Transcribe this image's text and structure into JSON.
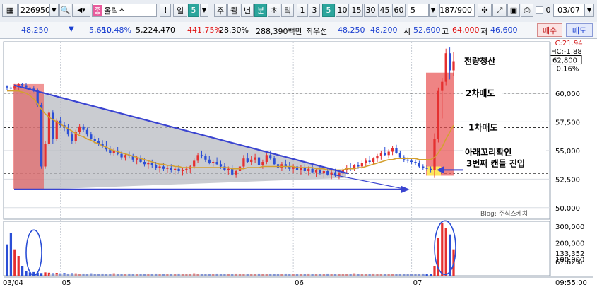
{
  "toolbar": {
    "stock_code": "226950",
    "stock_badge": "종",
    "stock_name": "올릭스",
    "period_label": "일",
    "period_value": "5",
    "periods": [
      "주",
      "월",
      "년",
      "분",
      "초",
      "틱"
    ],
    "minute_options": [
      "1",
      "3",
      "5",
      "10",
      "15",
      "30",
      "45",
      "60"
    ],
    "count_value": "5",
    "page_info": "187/900",
    "checkbox_value": "0",
    "date": "03/07"
  },
  "quote": {
    "price": "48,250",
    "change_arrow": "▼",
    "change": "5,650",
    "change_pct": "-10.48%",
    "volume": "5,224,470",
    "volume_ratio": "441.75%",
    "turnover": "28.30%",
    "amount": "288,390백만",
    "priority_label": "최우선",
    "ask": "48,250",
    "bid": "48,200",
    "open_label": "시",
    "open": "52,600",
    "high_label": "고",
    "high": "64,000",
    "low_label": "저",
    "low": "46,600",
    "buy_button": "매수",
    "sell_button": "매도"
  },
  "chart": {
    "right_top_lc": "LC:21.94",
    "right_top_hc": "HC:-1.88",
    "current_price_tag": "62,800",
    "current_pct_tag": "-0.16%",
    "price_ticks": [
      "60,000",
      "57,500",
      "55,000",
      "52,500",
      "50,000"
    ],
    "volume_ticks": [
      "300,000",
      "200,000",
      "100,000"
    ],
    "volume_tag": "133,352",
    "volume_pct_tag": "67.62%",
    "date_labels": [
      "03/04",
      "05",
      "06",
      "07"
    ],
    "time_label": "09:55:00",
    "annotations": {
      "all_sell": "전량청산",
      "second_sell": "2차매도",
      "first_sell": "1차매도",
      "confirm_line1": "아래꼬리확인",
      "confirm_line2": "3번째 캔들 진입",
      "blog": "Blog: 주식스케치"
    },
    "colors": {
      "up": "#e53030",
      "down": "#2b4fd6",
      "ma": "#d4a030",
      "triangle": "#3a44d0",
      "highlight": "#e85050"
    }
  },
  "chart_data": {
    "type": "candlestick",
    "y_axis_range": [
      49000,
      64500
    ],
    "reference_levels": [
      60000,
      57000,
      53000
    ],
    "candles": [
      [
        60600,
        60700,
        60300,
        60500
      ],
      [
        60500,
        60700,
        60300,
        60400
      ],
      [
        60400,
        60800,
        60200,
        60600
      ],
      [
        60600,
        60900,
        60300,
        60800
      ],
      [
        60800,
        60900,
        60500,
        60700
      ],
      [
        60700,
        60900,
        60400,
        60500
      ],
      [
        60500,
        60700,
        60300,
        60400
      ],
      [
        60400,
        60600,
        60100,
        60300
      ],
      [
        60300,
        60400,
        58800,
        59000
      ],
      [
        59000,
        59200,
        53400,
        53600
      ],
      [
        53600,
        55800,
        53400,
        55600
      ],
      [
        55600,
        58600,
        55400,
        58300
      ],
      [
        58300,
        58500,
        55600,
        56000
      ],
      [
        56000,
        57800,
        55800,
        57600
      ],
      [
        57600,
        57900,
        57000,
        57200
      ],
      [
        57200,
        57500,
        56700,
        57000
      ],
      [
        57000,
        57300,
        56200,
        56400
      ],
      [
        56400,
        56600,
        55600,
        55800
      ],
      [
        55800,
        56800,
        55600,
        56600
      ],
      [
        56600,
        57300,
        56400,
        57100
      ],
      [
        57100,
        57300,
        56600,
        56800
      ],
      [
        56800,
        57000,
        56200,
        56400
      ],
      [
        56400,
        56600,
        55800,
        56000
      ],
      [
        56000,
        56300,
        55600,
        55800
      ],
      [
        55800,
        56100,
        55400,
        55600
      ],
      [
        55600,
        55900,
        55200,
        55400
      ],
      [
        55400,
        55800,
        54900,
        55100
      ],
      [
        55100,
        55400,
        54600,
        54800
      ],
      [
        54800,
        55200,
        54500,
        55000
      ],
      [
        55000,
        55300,
        54600,
        54700
      ],
      [
        54700,
        54900,
        54200,
        54400
      ],
      [
        54400,
        54800,
        54100,
        54600
      ],
      [
        54600,
        54900,
        54300,
        54500
      ],
      [
        54500,
        54700,
        54000,
        54200
      ],
      [
        54200,
        54500,
        53800,
        54300
      ],
      [
        54300,
        54600,
        53900,
        54000
      ],
      [
        54000,
        54300,
        53600,
        53800
      ],
      [
        53800,
        54100,
        53400,
        53900
      ],
      [
        53900,
        54200,
        53500,
        53700
      ],
      [
        53700,
        54000,
        53300,
        53500
      ],
      [
        53500,
        53800,
        53100,
        53600
      ],
      [
        53600,
        53900,
        53200,
        53400
      ],
      [
        53400,
        53700,
        53000,
        53500
      ],
      [
        53500,
        53800,
        53100,
        53300
      ],
      [
        53300,
        53600,
        52900,
        53400
      ],
      [
        53400,
        53700,
        53000,
        53200
      ],
      [
        53200,
        53500,
        52800,
        53300
      ],
      [
        53300,
        53600,
        53000,
        53400
      ],
      [
        53400,
        53700,
        53000,
        53600
      ],
      [
        53600,
        54300,
        53400,
        54100
      ],
      [
        54100,
        54800,
        53900,
        54600
      ],
      [
        54600,
        55000,
        54300,
        54500
      ],
      [
        54500,
        54700,
        54000,
        54200
      ],
      [
        54200,
        54500,
        53800,
        53900
      ],
      [
        53900,
        54200,
        53600,
        54000
      ],
      [
        54000,
        54400,
        53700,
        53800
      ],
      [
        53800,
        54100,
        53400,
        53600
      ],
      [
        53600,
        53900,
        53200,
        53300
      ],
      [
        53300,
        53600,
        52900,
        53400
      ],
      [
        53400,
        53700,
        52800,
        52900
      ],
      [
        52900,
        53300,
        52600,
        53200
      ],
      [
        53200,
        53800,
        53000,
        53600
      ],
      [
        53600,
        54600,
        53400,
        54300
      ],
      [
        54300,
        54800,
        53900,
        54000
      ],
      [
        54000,
        54500,
        53700,
        54200
      ],
      [
        54200,
        54700,
        53900,
        54400
      ],
      [
        54400,
        54600,
        53600,
        53700
      ],
      [
        53700,
        54200,
        53400,
        54000
      ],
      [
        54000,
        54800,
        53800,
        54600
      ],
      [
        54600,
        55000,
        54200,
        54300
      ],
      [
        54300,
        54500,
        53700,
        53800
      ],
      [
        53800,
        54100,
        53300,
        53500
      ],
      [
        53500,
        54000,
        53200,
        53800
      ],
      [
        53800,
        54200,
        53400,
        53600
      ],
      [
        53600,
        54000,
        53200,
        53400
      ],
      [
        53400,
        53800,
        53000,
        53600
      ],
      [
        53600,
        53900,
        53200,
        53300
      ],
      [
        53300,
        53700,
        52900,
        53500
      ],
      [
        53500,
        53800,
        53000,
        53200
      ],
      [
        53200,
        53600,
        52800,
        53400
      ],
      [
        53400,
        53700,
        53000,
        53100
      ],
      [
        53100,
        53500,
        52700,
        53300
      ],
      [
        53300,
        53600,
        52900,
        53000
      ],
      [
        53000,
        53400,
        52600,
        53200
      ],
      [
        53200,
        53500,
        52800,
        52900
      ],
      [
        52900,
        53300,
        52500,
        53100
      ],
      [
        53100,
        53400,
        52700,
        52800
      ],
      [
        52800,
        53200,
        52500,
        53000
      ],
      [
        53000,
        53500,
        52800,
        53300
      ],
      [
        53300,
        53700,
        53000,
        53500
      ],
      [
        53500,
        53900,
        53200,
        53400
      ],
      [
        53400,
        53800,
        53200,
        53700
      ],
      [
        53700,
        54000,
        53400,
        53600
      ],
      [
        53600,
        54100,
        53400,
        53900
      ],
      [
        53900,
        54300,
        53600,
        54100
      ],
      [
        54100,
        54500,
        53800,
        54000
      ],
      [
        54000,
        54400,
        53700,
        54300
      ],
      [
        54300,
        54700,
        54000,
        54500
      ],
      [
        54500,
        55000,
        54200,
        54800
      ],
      [
        54800,
        55300,
        54500,
        54600
      ],
      [
        54600,
        55100,
        54300,
        54900
      ],
      [
        54900,
        55400,
        54600,
        55200
      ],
      [
        55200,
        55500,
        54700,
        54800
      ],
      [
        54800,
        55000,
        54300,
        54400
      ],
      [
        54400,
        54600,
        54000,
        54200
      ],
      [
        54200,
        54400,
        53900,
        54100
      ],
      [
        54100,
        54300,
        53800,
        54000
      ],
      [
        54000,
        54200,
        53700,
        53900
      ],
      [
        53900,
        54100,
        53500,
        53600
      ],
      [
        53600,
        53800,
        53300,
        53500
      ],
      [
        53500,
        53700,
        53200,
        53400
      ],
      [
        53400,
        53600,
        53100,
        53300
      ],
      [
        53300,
        56500,
        52600,
        56000
      ],
      [
        56000,
        60500,
        55700,
        60200
      ],
      [
        60200,
        61300,
        57800,
        61000
      ],
      [
        61000,
        63900,
        60700,
        63500
      ],
      [
        63500,
        64000,
        61200,
        62000
      ],
      [
        62000,
        63600,
        61500,
        62800
      ]
    ],
    "ma_series": [
      60200,
      60200,
      60200,
      60200,
      60100,
      60000,
      59800,
      59500,
      59100,
      58600,
      58200,
      57900,
      57700,
      57500,
      57300,
      57100,
      56900,
      56700,
      56500,
      56300,
      56200,
      56000,
      55900,
      55700,
      55600,
      55400,
      55300,
      55100,
      55000,
      54900,
      54800,
      54700,
      54600,
      54500,
      54400,
      54300,
      54200,
      54100,
      54000,
      53900,
      53800,
      53800,
      53700,
      53700,
      53600,
      53600,
      53500,
      53500,
      53500,
      53500,
      53500,
      53500,
      53500,
      53500,
      53500,
      53500,
      53500,
      53500,
      53500,
      53400,
      53400,
      53400,
      53400,
      53500,
      53500,
      53500,
      53500,
      53600,
      53600,
      53600,
      53600,
      53600,
      53600,
      53600,
      53600,
      53600,
      53500,
      53500,
      53500,
      53500,
      53500,
      53400,
      53400,
      53400,
      53300,
      53300,
      53300,
      53300,
      53300,
      53400,
      53400,
      53400,
      53500,
      53500,
      53600,
      53700,
      53800,
      53900,
      54000,
      54100,
      54200,
      54200,
      54300,
      54300,
      54300,
      54300,
      54300,
      54300,
      54200,
      54200,
      54200,
      54200,
      54400,
      54800,
      55300,
      56000,
      56600,
      57200
    ],
    "volume": [
      190000,
      260000,
      160000,
      120000,
      60000,
      30000,
      20000,
      22000,
      18000,
      16000,
      20000,
      18000,
      15000,
      17000,
      14000,
      16000,
      13000,
      15000,
      14000,
      12000,
      13000,
      12000,
      14000,
      11000,
      12000,
      13000,
      11000,
      12000,
      14000,
      10000,
      12000,
      11000,
      13000,
      10000,
      12000,
      11000,
      10000,
      12000,
      11000,
      13000,
      10000,
      11000,
      12000,
      10000,
      11000,
      13000,
      10000,
      12000,
      11000,
      14000,
      12000,
      10000,
      11000,
      12000,
      10000,
      13000,
      11000,
      10000,
      12000,
      11000,
      13000,
      10000,
      12000,
      11000,
      10000,
      12000,
      13000,
      11000,
      12000,
      10000,
      11000,
      12000,
      10000,
      13000,
      11000,
      12000,
      10000,
      11000,
      12000,
      13000,
      11000,
      10000,
      12000,
      11000,
      13000,
      10000,
      12000,
      11000,
      10000,
      12000,
      11000,
      14000,
      12000,
      10000,
      11000,
      12000,
      13000,
      11000,
      10000,
      12000,
      11000,
      12000,
      10000,
      11000,
      12000,
      10000,
      11000,
      12000,
      10000,
      13000,
      11000,
      12000,
      60000,
      230000,
      320000,
      290000,
      250000,
      160000
    ],
    "volume_range": [
      0,
      330000
    ]
  }
}
